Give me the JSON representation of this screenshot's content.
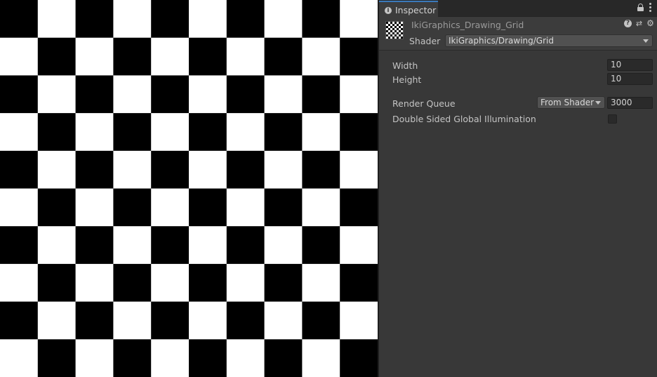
{
  "preview": {
    "board": {
      "columns": 10,
      "rows": 10,
      "dark_color": "#000000",
      "light_color": "#ffffff"
    }
  },
  "inspector": {
    "tab_label": "Inspector",
    "material_name": "IkiGraphics_Drawing_Grid",
    "shader_label": "Shader",
    "shader_value": "IkiGraphics/Drawing/Grid",
    "properties": {
      "width_label": "Width",
      "width_value": "10",
      "height_label": "Height",
      "height_value": "10",
      "render_queue_label": "Render Queue",
      "render_queue_mode": "From Shader",
      "render_queue_value": "3000",
      "double_sided_gi_label": "Double Sided Global Illumination",
      "double_sided_gi_checked": false
    }
  },
  "icons": {
    "tab": "info-icon",
    "lock": "lock-icon",
    "menu": "kebab-menu-icon",
    "help": "help-icon",
    "presets": "presets-icon",
    "settings": "gear-icon"
  },
  "colors": {
    "panel_bg": "#383838",
    "tab_accent": "#3a79bb",
    "field_bg": "#2a2a2a",
    "dropdown_bg": "#515151"
  }
}
